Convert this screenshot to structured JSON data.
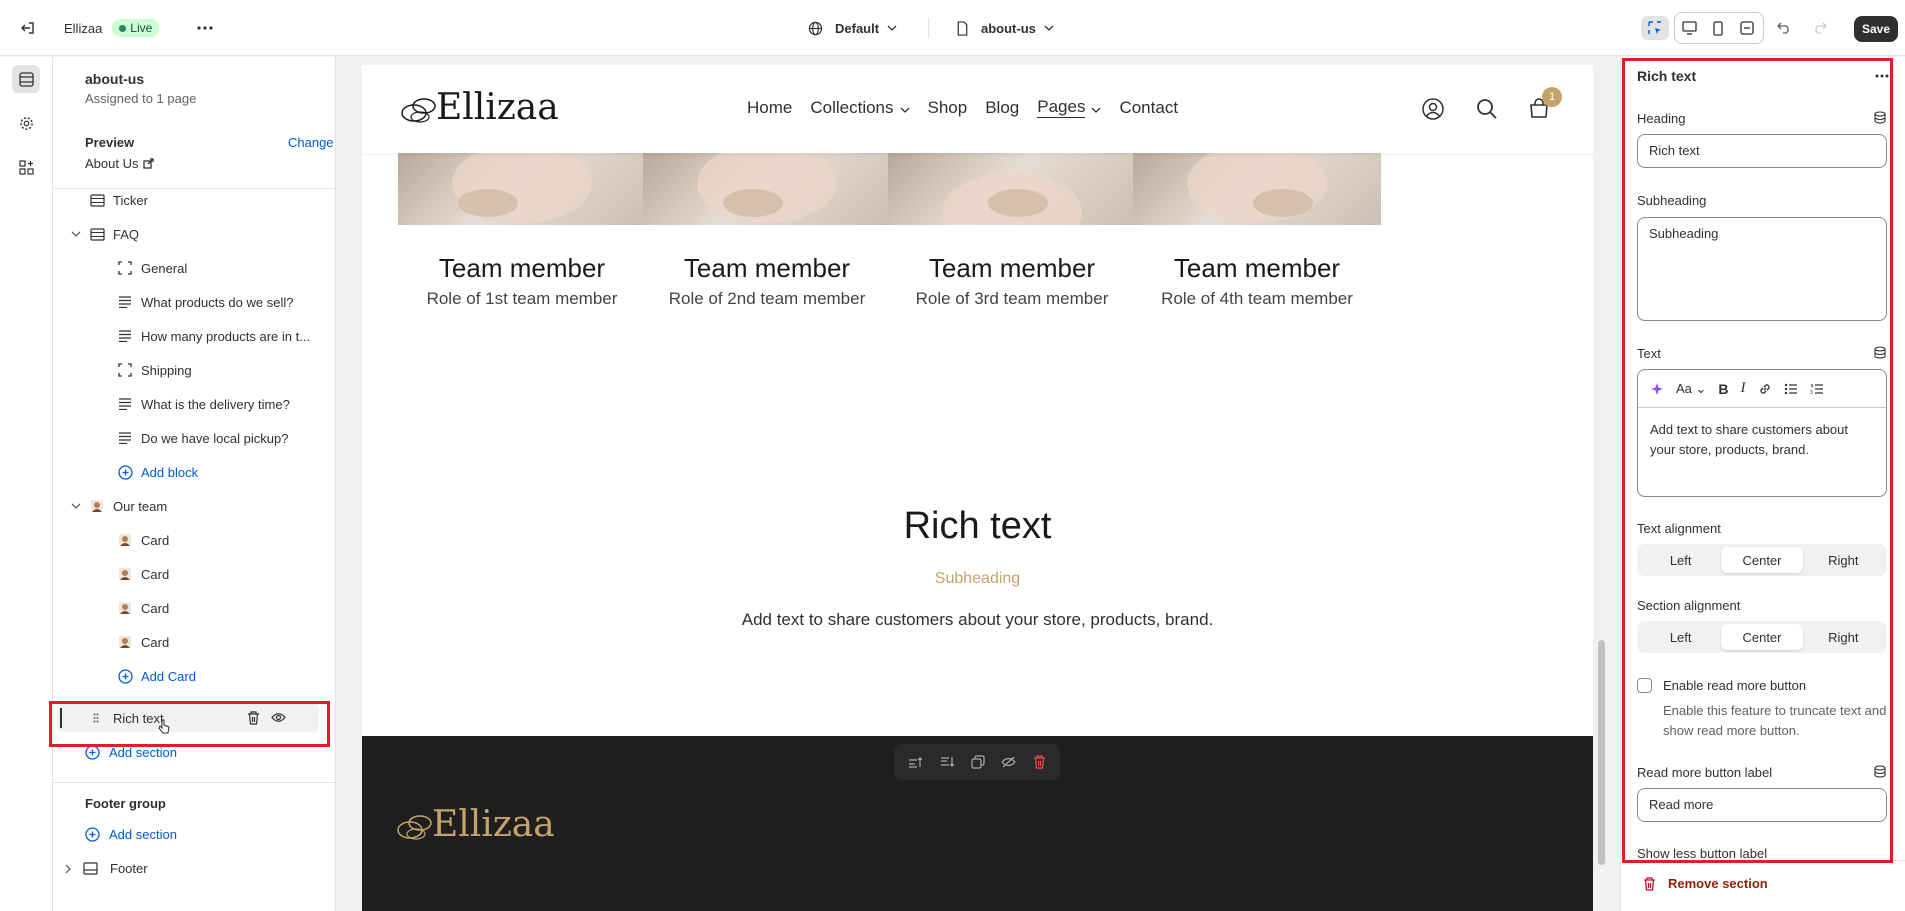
{
  "topbar": {
    "exit_label": "",
    "store_name": "Ellizaa",
    "live_label": "Live",
    "theme_label": "Default",
    "page_label": "about-us",
    "save_label": "Save"
  },
  "left": {
    "template_name": "about-us",
    "assigned": "Assigned to 1 page",
    "preview_label": "Preview",
    "change_label": "Change",
    "preview_page": "About Us",
    "tree": [
      {
        "label": "Ticker",
        "icon": "section-icon",
        "indent": 1,
        "blue": false
      },
      {
        "label": "FAQ",
        "icon": "section-icon",
        "indent": 1,
        "blue": false,
        "chevron": true
      },
      {
        "label": "General",
        "icon": "block-frame-icon",
        "indent": 2,
        "blue": false
      },
      {
        "label": "What products do we sell?",
        "icon": "text-lines-icon",
        "indent": 2,
        "blue": false
      },
      {
        "label": "How many products are in t...",
        "icon": "text-lines-icon",
        "indent": 2,
        "blue": false
      },
      {
        "label": "Shipping",
        "icon": "block-frame-icon",
        "indent": 2,
        "blue": false
      },
      {
        "label": "What is the delivery time?",
        "icon": "text-lines-icon",
        "indent": 2,
        "blue": false
      },
      {
        "label": "Do we have local pickup?",
        "icon": "text-lines-icon",
        "indent": 2,
        "blue": false
      },
      {
        "label": "Add block",
        "icon": "add-circle-icon",
        "indent": 2,
        "blue": true
      },
      {
        "label": "Our team",
        "icon": "avatar-icon",
        "indent": 1,
        "blue": false,
        "chevron": true
      },
      {
        "label": "Card",
        "icon": "avatar-icon",
        "indent": 2,
        "blue": false
      },
      {
        "label": "Card",
        "icon": "avatar-icon",
        "indent": 2,
        "blue": false
      },
      {
        "label": "Card",
        "icon": "avatar-icon",
        "indent": 2,
        "blue": false
      },
      {
        "label": "Card",
        "icon": "avatar-icon",
        "indent": 2,
        "blue": false
      },
      {
        "label": "Add Card",
        "icon": "add-circle-icon",
        "indent": 2,
        "blue": true
      }
    ],
    "rich_text_item": "Rich text",
    "add_section": "Add section",
    "footer_group": "Footer group",
    "add_section_2": "Add section",
    "footer_label": "Footer"
  },
  "store": {
    "logo": "Ellizaa",
    "nav": [
      "Home",
      "Collections",
      "Shop",
      "Blog",
      "Pages",
      "Contact"
    ],
    "cart_count": "1",
    "team": [
      {
        "name": "Team member",
        "role": "Role of 1st team member"
      },
      {
        "name": "Team member",
        "role": "Role of 2nd team member"
      },
      {
        "name": "Team member",
        "role": "Role of 3rd team member"
      },
      {
        "name": "Team member",
        "role": "Role of 4th team member"
      }
    ],
    "rich_heading": "Rich text",
    "rich_sub": "Subheading",
    "rich_text": "Add text to share customers about your store, products, brand.",
    "footer_logo": "Ellizaa"
  },
  "right": {
    "title": "Rich text",
    "heading_label": "Heading",
    "heading_value": "Rich text",
    "subheading_label": "Subheading",
    "subheading_value": "Subheading",
    "text_label": "Text",
    "text_value": "Add text to share customers about your store, products, brand.",
    "text_align_label": "Text alignment",
    "section_align_label": "Section alignment",
    "align_opts": [
      "Left",
      "Center",
      "Right"
    ],
    "read_more_label": "Enable read more button",
    "read_more_help": "Enable this feature to truncate text and show read more button.",
    "read_more_btn_label": "Read more button label",
    "read_more_value": "Read more",
    "show_less_label": "Show less button label",
    "remove_label": "Remove section"
  },
  "colors": {
    "accent": "#005bd3",
    "gold": "#c4a46a",
    "dark_footer": "#1f1f1f",
    "highlight": "#e11d2a"
  }
}
